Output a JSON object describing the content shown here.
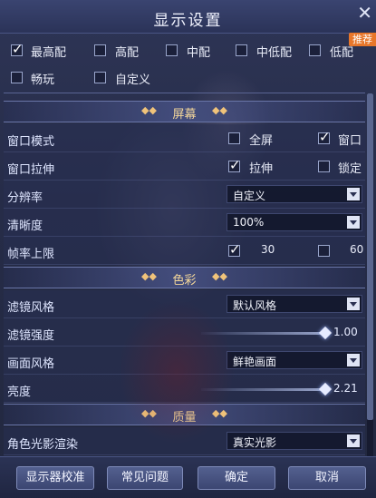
{
  "window": {
    "title": "显示设置",
    "close": "✕",
    "badge": "推荐"
  },
  "presets": [
    {
      "label": "最高配",
      "checked": true
    },
    {
      "label": "高配",
      "checked": false
    },
    {
      "label": "中配",
      "checked": false
    },
    {
      "label": "中低配",
      "checked": false
    },
    {
      "label": "低配",
      "checked": false
    },
    {
      "label": "畅玩",
      "checked": false
    },
    {
      "label": "自定义",
      "checked": false
    }
  ],
  "sections": {
    "screen": "屏幕",
    "color": "色彩",
    "quality": "质量"
  },
  "screen": {
    "window_mode": {
      "label": "窗口模式",
      "options": [
        {
          "label": "全屏",
          "checked": false
        },
        {
          "label": "窗口",
          "checked": true
        }
      ]
    },
    "window_stretch": {
      "label": "窗口拉伸",
      "options": [
        {
          "label": "拉伸",
          "checked": true
        },
        {
          "label": "锁定",
          "checked": false
        }
      ]
    },
    "resolution": {
      "label": "分辨率",
      "value": "自定义"
    },
    "clarity": {
      "label": "清晰度",
      "value": "100%"
    },
    "frame_limit": {
      "label": "帧率上限",
      "options": [
        {
          "label": "30",
          "checked": true
        },
        {
          "label": "60",
          "checked": false
        }
      ]
    }
  },
  "color": {
    "filter_style": {
      "label": "滤镜风格",
      "value": "默认风格"
    },
    "filter_intensity": {
      "label": "滤镜强度",
      "value": "1.00",
      "fraction": 1.0
    },
    "picture_style": {
      "label": "画面风格",
      "value": "鲜艳画面"
    },
    "brightness": {
      "label": "亮度",
      "value": "2.21",
      "fraction": 1.0
    }
  },
  "quality": {
    "character_lighting": {
      "label": "角色光影渲染",
      "value": "真实光影"
    }
  },
  "buttons": {
    "calibrate": "显示器校准",
    "faq": "常见问题",
    "confirm": "确定",
    "cancel": "取消"
  }
}
